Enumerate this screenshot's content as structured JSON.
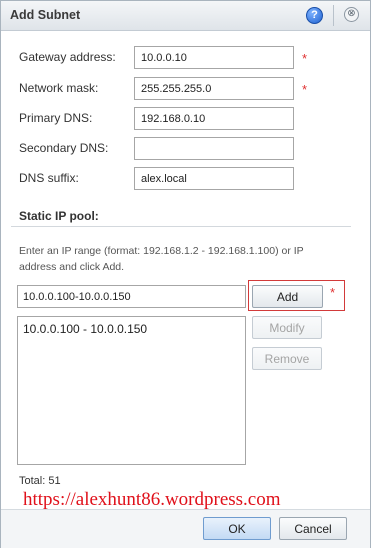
{
  "dialog": {
    "title": "Add Subnet",
    "help_icon": "?",
    "close_icon": "⊗"
  },
  "fields": {
    "gateway": {
      "label": "Gateway address:",
      "value": "10.0.0.10",
      "required": true
    },
    "netmask": {
      "label": "Network mask:",
      "value": "255.255.255.0",
      "required": true
    },
    "primary_dns": {
      "label": "Primary DNS:",
      "value": "192.168.0.10"
    },
    "secondary_dns": {
      "label": "Secondary DNS:",
      "value": ""
    },
    "dns_suffix": {
      "label": "DNS suffix:",
      "value": "alex.local"
    },
    "required_mark": "*"
  },
  "pool": {
    "title": "Static IP pool:",
    "hint": "Enter an IP range (format: 192.168.1.2 - 192.168.1.100) or IP address and click Add.",
    "range_input_value": "10.0.0.100-10.0.0.150",
    "add_label": "Add",
    "modify_label": "Modify",
    "remove_label": "Remove",
    "ranges": [
      "10.0.0.100 - 10.0.0.150"
    ],
    "total": "Total: 51"
  },
  "watermark": "https://alexhunt86.wordpress.com",
  "footer": {
    "ok_label": "OK",
    "cancel_label": "Cancel"
  },
  "colors": {
    "required": "#e03030",
    "highlight_box": "#d23a3a",
    "watermark": "#e0101a"
  }
}
